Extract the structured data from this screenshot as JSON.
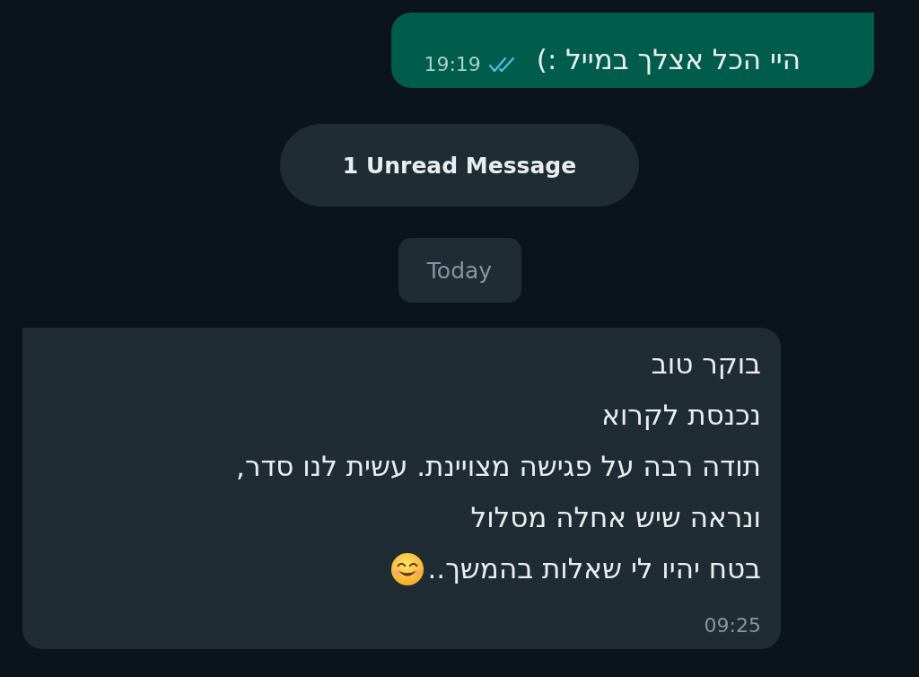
{
  "messages": [
    {
      "kind": "outgoing",
      "lines": [
        "היי הכל אצלך במייל :)"
      ],
      "time": "19:19",
      "read": true
    },
    {
      "kind": "unread_banner",
      "text": "1 Unread Message"
    },
    {
      "kind": "date",
      "text": "Today"
    },
    {
      "kind": "incoming",
      "lines": [
        "בוקר טוב",
        "נכנסת לקרוא",
        "תודה רבה על פגישה מצויינת. עשית לנו סדר,",
        "ונראה שיש אחלה מסלול",
        "בטח יהיו לי שאלות בהמשך.."
      ],
      "emoji_end": true,
      "time": "09:25"
    }
  ]
}
